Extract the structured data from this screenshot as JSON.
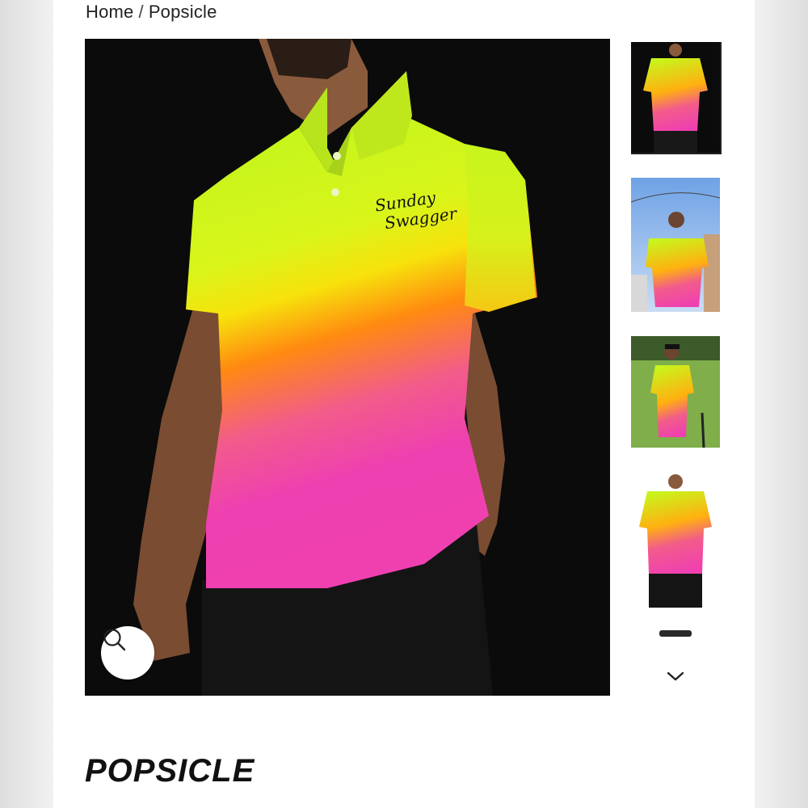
{
  "breadcrumb": {
    "home": "Home",
    "separator": "/",
    "current": "Popsicle"
  },
  "product": {
    "title": "POPSICLE",
    "brand_script": [
      "Sunday",
      "Swagger"
    ],
    "colors": {
      "neon_yellow": "#c8f51c",
      "orange": "#ff8a10",
      "pink": "#f040b0"
    }
  },
  "gallery": {
    "zoom_icon": "magnifier-icon",
    "next_icon": "chevron-down-icon",
    "thumbnails": [
      {
        "scene": "studio-black",
        "active": true
      },
      {
        "scene": "outdoor-sky"
      },
      {
        "scene": "golf-course"
      },
      {
        "scene": "studio-white"
      },
      {
        "scene": "partial"
      }
    ]
  }
}
